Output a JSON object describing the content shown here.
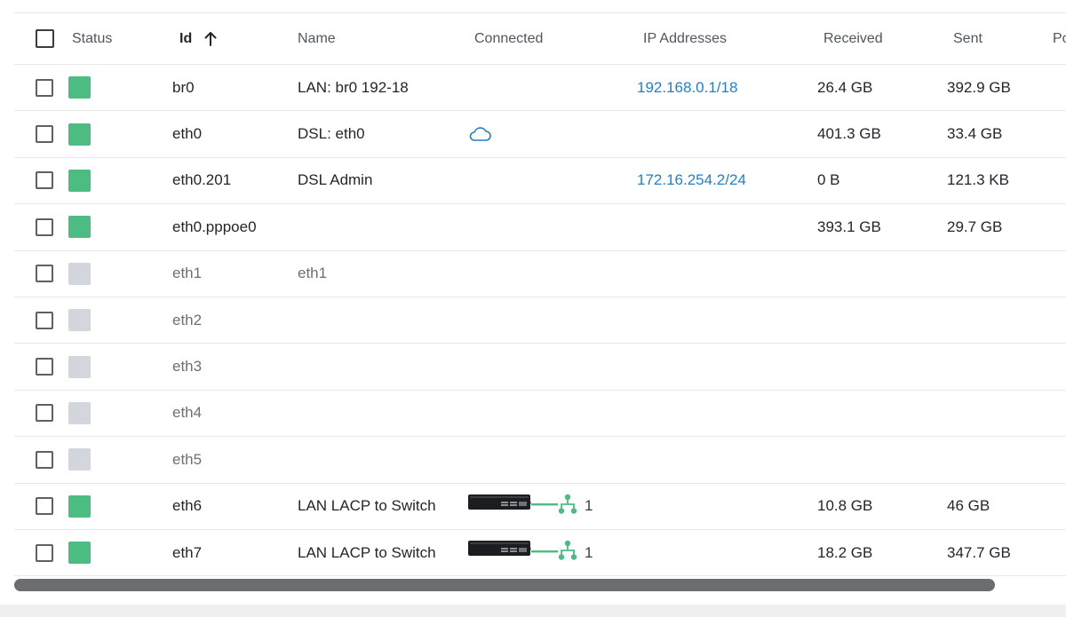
{
  "colors": {
    "status_up": "#4cbc83",
    "status_down": "#d4d6de",
    "link": "#1f7fd1",
    "accent_green": "#4cbc83"
  },
  "columns": {
    "status": "Status",
    "id": "Id",
    "name": "Name",
    "connected": "Connected",
    "ip": "IP Addresses",
    "received": "Received",
    "sent": "Sent",
    "port": "Po"
  },
  "sort": {
    "column": "id",
    "direction": "ascending",
    "icon": "arrow-up-icon"
  },
  "rows": [
    {
      "status": "up",
      "id": "br0",
      "name": "LAN: br0 192-18",
      "connected": "",
      "ip": "192.168.0.1/18",
      "received": "26.4 GB",
      "sent": "392.9 GB"
    },
    {
      "status": "up",
      "id": "eth0",
      "name": "DSL: eth0",
      "connected": "cloud-icon",
      "ip": "",
      "received": "401.3 GB",
      "sent": "33.4 GB"
    },
    {
      "status": "up",
      "id": "eth0.201",
      "name": "DSL Admin",
      "connected": "",
      "ip": "172.16.254.2/24",
      "received": "0 B",
      "sent": "121.3 KB"
    },
    {
      "status": "up",
      "id": "eth0.pppoe0",
      "name": "",
      "connected": "",
      "ip": "",
      "received": "393.1 GB",
      "sent": "29.7 GB"
    },
    {
      "status": "down",
      "id": "eth1",
      "name": "eth1",
      "connected": "",
      "ip": "",
      "received": "",
      "sent": ""
    },
    {
      "status": "down",
      "id": "eth2",
      "name": "",
      "connected": "",
      "ip": "",
      "received": "",
      "sent": ""
    },
    {
      "status": "down",
      "id": "eth3",
      "name": "",
      "connected": "",
      "ip": "",
      "received": "",
      "sent": ""
    },
    {
      "status": "down",
      "id": "eth4",
      "name": "",
      "connected": "",
      "ip": "",
      "received": "",
      "sent": ""
    },
    {
      "status": "down",
      "id": "eth5",
      "name": "",
      "connected": "",
      "ip": "",
      "received": "",
      "sent": ""
    },
    {
      "status": "up",
      "id": "eth6",
      "name": "LAN LACP to Switch",
      "connected": "switch",
      "connected_count": "1",
      "ip": "",
      "received": "10.8 GB",
      "sent": "46 GB"
    },
    {
      "status": "up",
      "id": "eth7",
      "name": "LAN LACP to Switch",
      "connected": "switch",
      "connected_count": "1",
      "ip": "",
      "received": "18.2 GB",
      "sent": "347.7 GB"
    }
  ]
}
